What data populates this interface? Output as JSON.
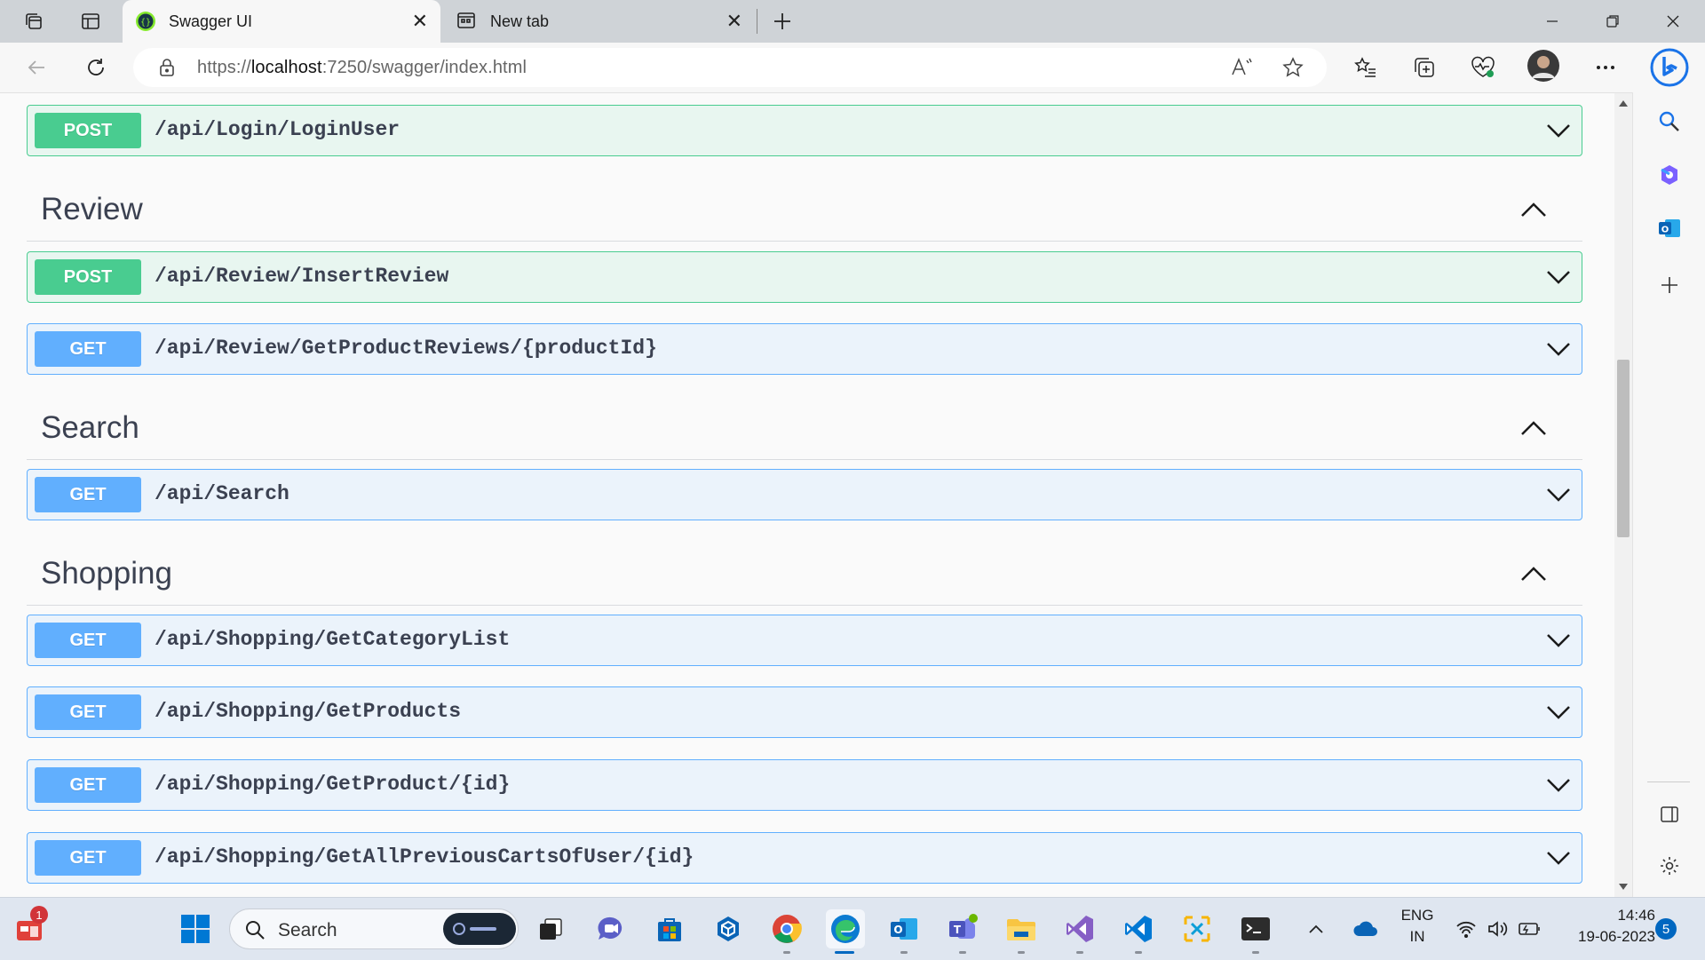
{
  "browser": {
    "tabs": [
      {
        "title": "Swagger UI",
        "active": true
      },
      {
        "title": "New tab",
        "active": false
      }
    ],
    "url_prefix": "https://",
    "url_host": "localhost",
    "url_rest": ":7250/swagger/index.html"
  },
  "swagger": {
    "top_endpoint": {
      "method": "POST",
      "path": "/api/Login/LoginUser"
    },
    "sections": [
      {
        "name": "Review",
        "endpoints": [
          {
            "method": "POST",
            "path": "/api/Review/InsertReview"
          },
          {
            "method": "GET",
            "path": "/api/Review/GetProductReviews/{productId}"
          }
        ]
      },
      {
        "name": "Search",
        "endpoints": [
          {
            "method": "GET",
            "path": "/api/Search"
          }
        ]
      },
      {
        "name": "Shopping",
        "endpoints": [
          {
            "method": "GET",
            "path": "/api/Shopping/GetCategoryList"
          },
          {
            "method": "GET",
            "path": "/api/Shopping/GetProducts"
          },
          {
            "method": "GET",
            "path": "/api/Shopping/GetProduct/{id}"
          },
          {
            "method": "GET",
            "path": "/api/Shopping/GetAllPreviousCartsOfUser/{id}"
          }
        ]
      }
    ]
  },
  "taskbar": {
    "search_label": "Search",
    "widget_badge": "1",
    "language_line1": "ENG",
    "language_line2": "IN",
    "time": "14:46",
    "date": "19-06-2023",
    "notification_count": "5"
  },
  "colors": {
    "post": "#49cc90",
    "get": "#61affe",
    "accent": "#0067c0"
  }
}
